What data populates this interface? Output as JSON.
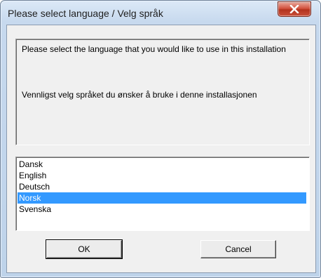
{
  "window": {
    "title": "Please select language / Velg språk",
    "close_icon": "close-x-icon"
  },
  "message": {
    "line1": "Please select the language that you would like to use in this installation",
    "line2": "Vennligst velg språket du ønsker å bruke i denne installasjonen"
  },
  "languages": {
    "items": [
      {
        "label": "Dansk",
        "selected": false
      },
      {
        "label": "English",
        "selected": false
      },
      {
        "label": "Deutsch",
        "selected": false
      },
      {
        "label": "Norsk",
        "selected": true
      },
      {
        "label": "Svenska",
        "selected": false
      }
    ]
  },
  "buttons": {
    "ok_label": "OK",
    "cancel_label": "Cancel"
  },
  "colors": {
    "selection": "#3399ff",
    "close_button": "#c9503a"
  }
}
